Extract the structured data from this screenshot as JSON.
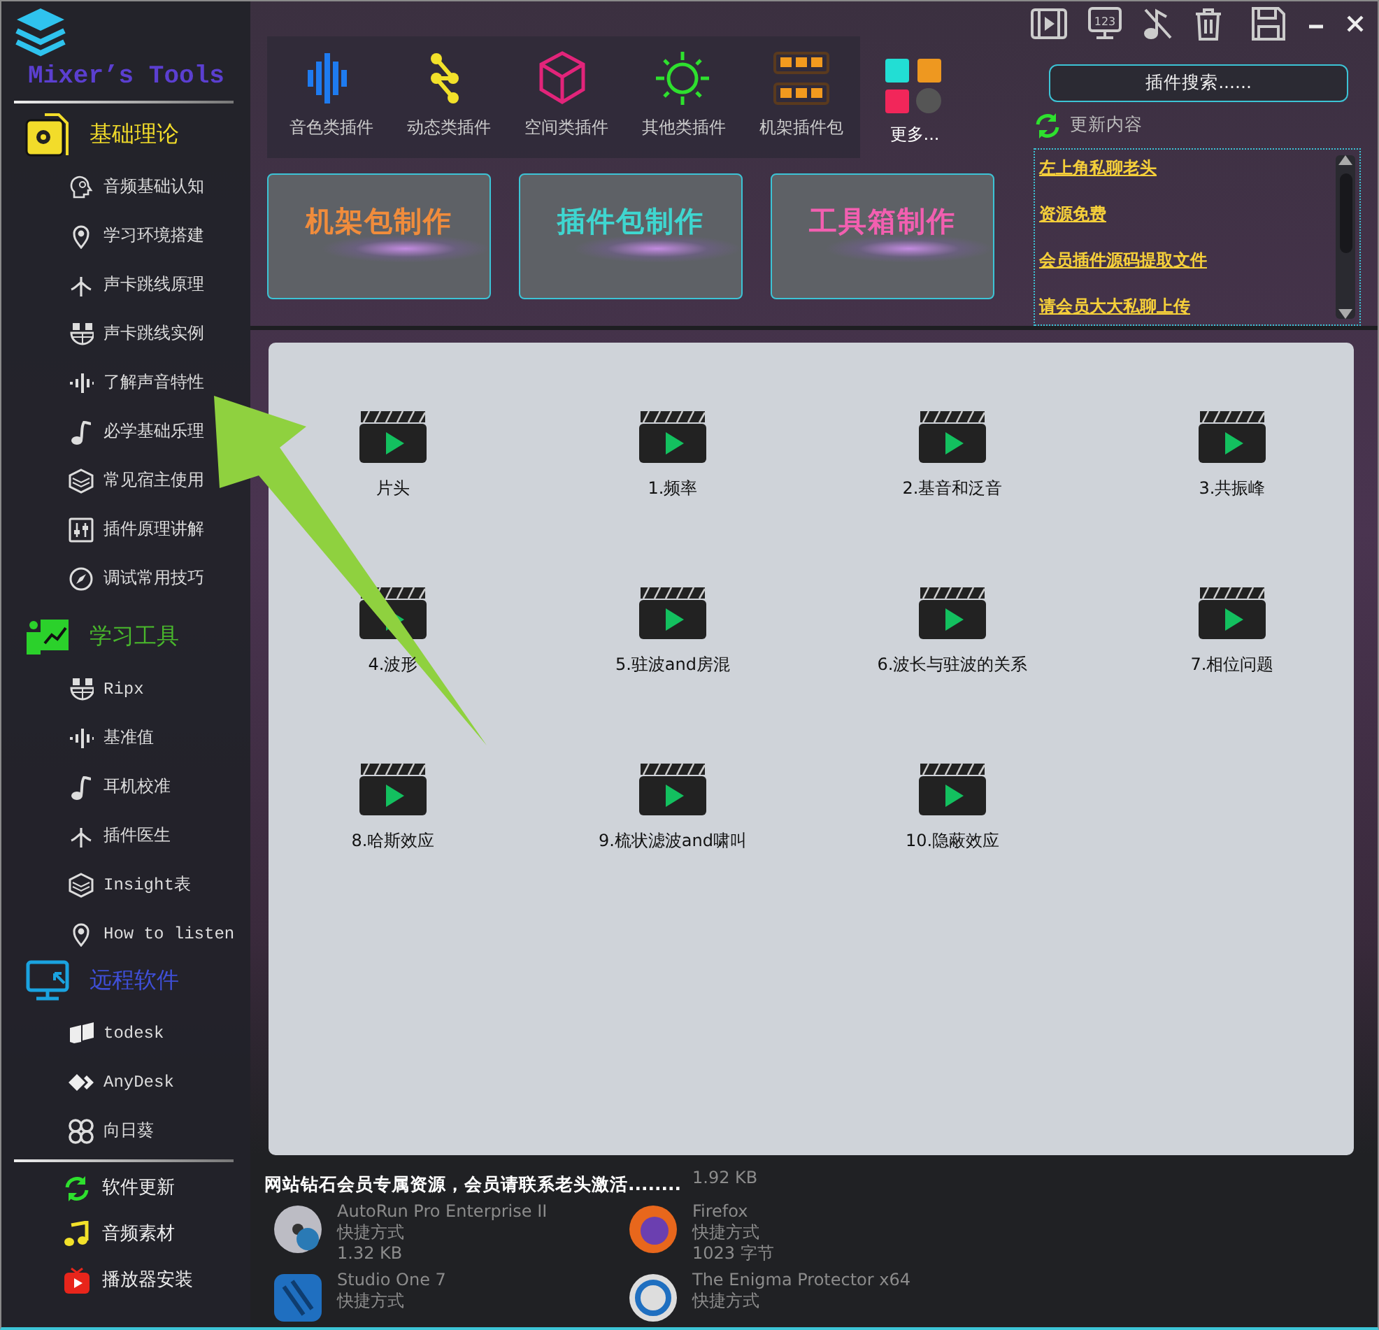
{
  "app": {
    "title": "Mixer’s Tools"
  },
  "sidebar": {
    "sections": [
      {
        "title": "基础理论",
        "color": "#f2dc2a",
        "items": [
          {
            "label": "音频基础认知"
          },
          {
            "label": "学习环境搭建"
          },
          {
            "label": "声卡跳线原理"
          },
          {
            "label": "声卡跳线实例"
          },
          {
            "label": "了解声音特性"
          },
          {
            "label": "必学基础乐理"
          },
          {
            "label": "常见宿主使用"
          },
          {
            "label": "插件原理讲解"
          },
          {
            "label": "调试常用技巧"
          }
        ]
      },
      {
        "title": "学习工具",
        "color": "#49b82c",
        "items": [
          {
            "label": "Ripx"
          },
          {
            "label": "基准值"
          },
          {
            "label": "耳机校准"
          },
          {
            "label": "插件医生"
          },
          {
            "label": "Insight表"
          },
          {
            "label": "How to listen"
          }
        ]
      },
      {
        "title": "远程软件",
        "color": "#3f4fd8",
        "items": [
          {
            "label": "todesk"
          },
          {
            "label": "AnyDesk"
          },
          {
            "label": "向日葵"
          }
        ]
      }
    ],
    "footer_items": [
      {
        "label": "软件更新"
      },
      {
        "label": "音频素材"
      },
      {
        "label": "播放器安装"
      }
    ]
  },
  "categories": [
    {
      "label": "音色类插件"
    },
    {
      "label": "动态类插件"
    },
    {
      "label": "空间类插件"
    },
    {
      "label": "其他类插件"
    },
    {
      "label": "机架插件包"
    }
  ],
  "more": {
    "label": "更多..."
  },
  "toolbar": {
    "display_label": "123"
  },
  "search": {
    "placeholder": "插件搜索......"
  },
  "updates": {
    "title": "更新内容",
    "links": [
      {
        "label": "左上角私聊老头"
      },
      {
        "label": "资源免费"
      },
      {
        "label": "会员插件源码提取文件"
      },
      {
        "label": "请会员大大私聊上传"
      }
    ]
  },
  "banners": [
    {
      "label": "机架包制作",
      "color": "#f08c3c"
    },
    {
      "label": "插件包制作",
      "color": "#3fd6d0"
    },
    {
      "label": "工具箱制作",
      "color": "#f25fb0"
    }
  ],
  "videos": [
    {
      "label": "片头"
    },
    {
      "label": "1.频率"
    },
    {
      "label": "2.基音和泛音"
    },
    {
      "label": "3.共振峰"
    },
    {
      "label": "4.波形"
    },
    {
      "label": "5.驻波and房混"
    },
    {
      "label": "6.波长与驻波的关系"
    },
    {
      "label": "7.相位问题"
    },
    {
      "label": "8.哈斯效应"
    },
    {
      "label": "9.梳状滤波and啸叫"
    },
    {
      "label": "10.隐蔽效应"
    }
  ],
  "notice": "网站钻石会员专属资源，会员请联系老头激活........",
  "desktop_items": [
    {
      "size": "1.92 KB"
    },
    {
      "lines": [
        "AutoRun Pro Enterprise II",
        "快捷方式"
      ],
      "size": "1.32 KB"
    },
    {
      "lines": [
        "Firefox",
        "快捷方式"
      ],
      "size": "1023 字节"
    },
    {
      "lines": [
        "Studio One 7",
        "快捷方式"
      ]
    },
    {
      "lines": [
        "The Enigma Protector x64",
        "快捷方式"
      ]
    }
  ]
}
